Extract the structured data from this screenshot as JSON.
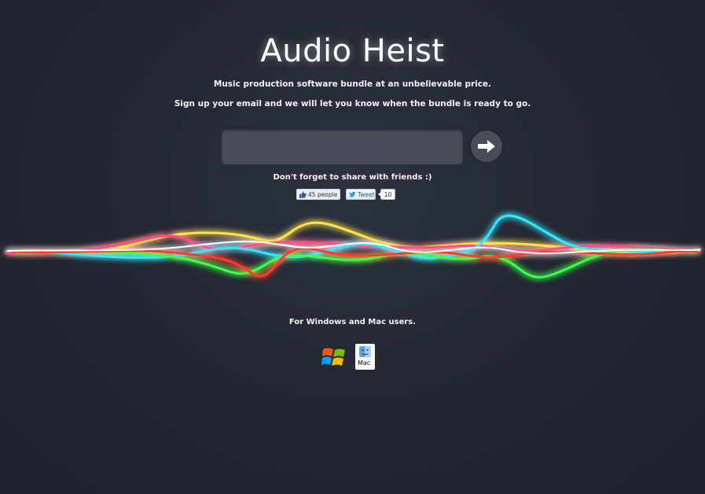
{
  "page": {
    "title": "Audio Heist",
    "tagline": "Music production software bundle at an unbelievable price.",
    "signup_text": "Sign up your email and we will let you know when the bundle is ready to go.",
    "email_input": {
      "value": "",
      "placeholder": ""
    },
    "submit_icon": "arrow-right-icon",
    "share_text": "Don't forget to share with friends :)",
    "social": {
      "like_label": "45 people",
      "tweet_label": "Tweet",
      "tweet_count": "10"
    },
    "platforms_text": "For Windows and Mac users.",
    "mac_label": "Mac"
  },
  "colors": {
    "background": "#232833",
    "input_bg": "#4a4d57",
    "wave": [
      "#ffe14d",
      "#ff4d8a",
      "#35e6ff",
      "#3cff4a",
      "#ff3b2f",
      "#ffffff"
    ]
  },
  "icons": [
    "arrow-right-icon",
    "facebook-like-icon",
    "twitter-bird-icon",
    "windows-logo-icon",
    "mac-finder-icon"
  ]
}
